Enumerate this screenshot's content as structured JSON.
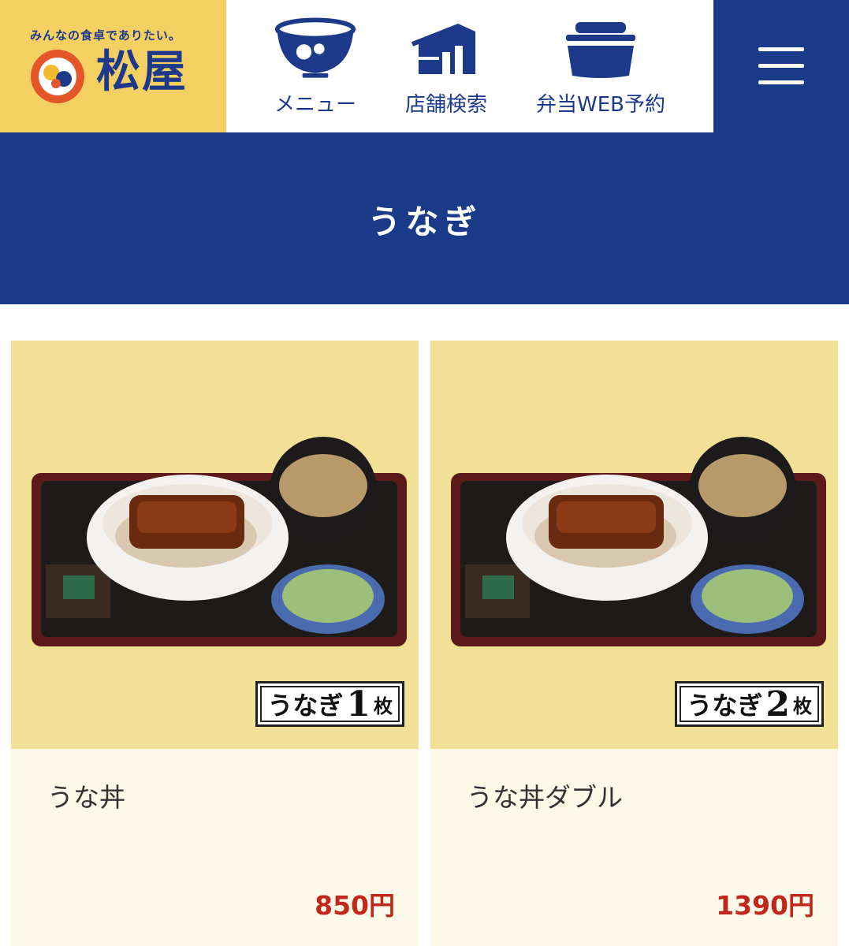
{
  "header": {
    "tagline": "みんなの食卓でありたい。",
    "logo_name": "松屋",
    "colors": {
      "brand_navy": "#1a3a8a",
      "logo_yellow": "#f4cf62",
      "logo_orange": "#e4552a"
    }
  },
  "nav": [
    {
      "label": "メニュー",
      "icon": "bowl-icon"
    },
    {
      "label": "店舗検索",
      "icon": "store-icon"
    },
    {
      "label": "弁当WEB予約",
      "icon": "bento-icon"
    }
  ],
  "menu_button": {
    "icon": "hamburger-icon"
  },
  "banner": {
    "title": "うなぎ"
  },
  "items": [
    {
      "name": "うな丼",
      "price": "850円",
      "badge_text": "うなぎ",
      "badge_num": "1",
      "badge_unit": "枚"
    },
    {
      "name": "うな丼ダブル",
      "price": "1390円",
      "badge_text": "うなぎ",
      "badge_num": "2",
      "badge_unit": "枚"
    }
  ]
}
